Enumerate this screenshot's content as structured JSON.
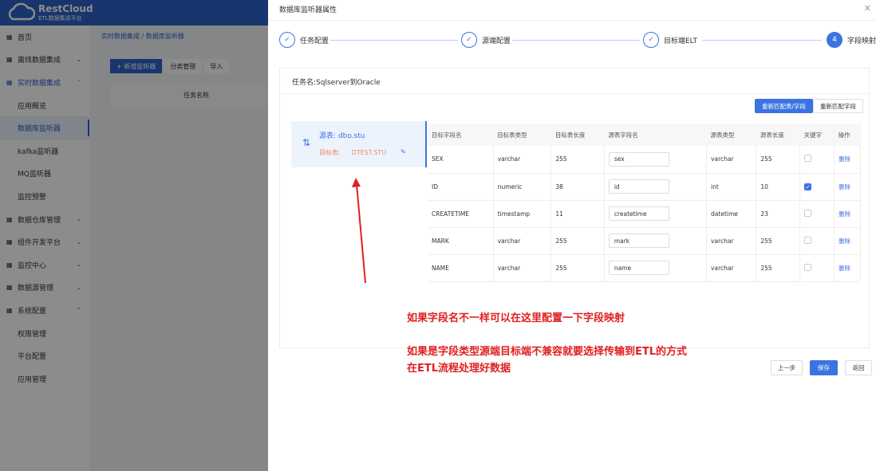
{
  "app": {
    "brand": "RestCloud",
    "subtitle": "ETL数据集成平台"
  },
  "sidebar": {
    "items": [
      {
        "label": "首页",
        "icon": "grid-icon"
      },
      {
        "label": "离线数据集成",
        "icon": "database-icon",
        "chevron": "down"
      },
      {
        "label": "实时数据集成",
        "icon": "realtime-icon",
        "chevron": "up",
        "open": true
      },
      {
        "label": "应用概览",
        "sub": true
      },
      {
        "label": "数据库监听器",
        "sub": true,
        "active": true
      },
      {
        "label": "kafka监听器",
        "sub": true
      },
      {
        "label": "MQ监听器",
        "sub": true
      },
      {
        "label": "监控预警",
        "sub": true
      },
      {
        "label": "数据仓库管理",
        "icon": "warehouse-icon",
        "chevron": "down"
      },
      {
        "label": "组件开发平台",
        "icon": "component-icon",
        "chevron": "down"
      },
      {
        "label": "监控中心",
        "icon": "monitor-icon",
        "chevron": "down"
      },
      {
        "label": "数据源管理",
        "icon": "datasource-icon",
        "chevron": "down"
      },
      {
        "label": "系统配置",
        "icon": "settings-icon",
        "chevron": "up"
      },
      {
        "label": "权限管理",
        "sub": true
      },
      {
        "label": "平台配置",
        "sub": true
      },
      {
        "label": "应用管理",
        "sub": true
      }
    ]
  },
  "background": {
    "breadcrumb": [
      "实时数据集成",
      "数据库监听器"
    ],
    "toolbar": [
      "+ 新增监听器",
      "分类管理",
      "导入"
    ],
    "column": "任务名称"
  },
  "drawer": {
    "title": "数据库监听器属性",
    "steps": [
      {
        "label": "任务配置",
        "done": true
      },
      {
        "label": "源端配置",
        "done": true
      },
      {
        "label": "目标端ELT",
        "done": true
      },
      {
        "label": "字段映射",
        "number": "4",
        "current": true
      }
    ],
    "task_name": "任务名:Sqlserver到Oracle",
    "rematch_table_button": "重新匹配表/字段",
    "rematch_field_button": "重新匹配字段",
    "table_item": {
      "source": "源表: dbo.stu",
      "target_label": "目标表:",
      "target": "DTEST.STU"
    },
    "columns": [
      "目标字段名",
      "目标表类型",
      "目标表长度",
      "源表字段名",
      "源表类型",
      "源表长度",
      "关键字",
      "操作"
    ],
    "rows": [
      {
        "target_field": "SEX",
        "target_type": "varchar",
        "target_len": "255",
        "source_field": "sex",
        "source_type": "varchar",
        "source_len": "255",
        "key": false,
        "action": "删除"
      },
      {
        "target_field": "ID",
        "target_type": "numeric",
        "target_len": "38",
        "source_field": "id",
        "source_type": "int",
        "source_len": "10",
        "key": true,
        "action": "删除"
      },
      {
        "target_field": "CREATETIME",
        "target_type": "timestamp",
        "target_len": "11",
        "source_field": "createtime",
        "source_type": "datetime",
        "source_len": "23",
        "key": false,
        "action": "删除"
      },
      {
        "target_field": "MARK",
        "target_type": "varchar",
        "target_len": "255",
        "source_field": "mark",
        "source_type": "varchar",
        "source_len": "255",
        "key": false,
        "action": "删除"
      },
      {
        "target_field": "NAME",
        "target_type": "varchar",
        "target_len": "255",
        "source_field": "name",
        "source_type": "varchar",
        "source_len": "255",
        "key": false,
        "action": "删除"
      }
    ],
    "prev_button": "上一步",
    "save_button": "保存",
    "back_button": "返回"
  },
  "annotations": [
    "如果字段名不一样可以在这里配置一下字段映射",
    "如果是字段类型源端目标端不兼容就要选择传输到ETL的方式",
    "在ETL流程处理好数据"
  ],
  "colors": {
    "primary": "#3b74e0",
    "annotation": "#e02020",
    "target_table": "#f08a5d"
  }
}
